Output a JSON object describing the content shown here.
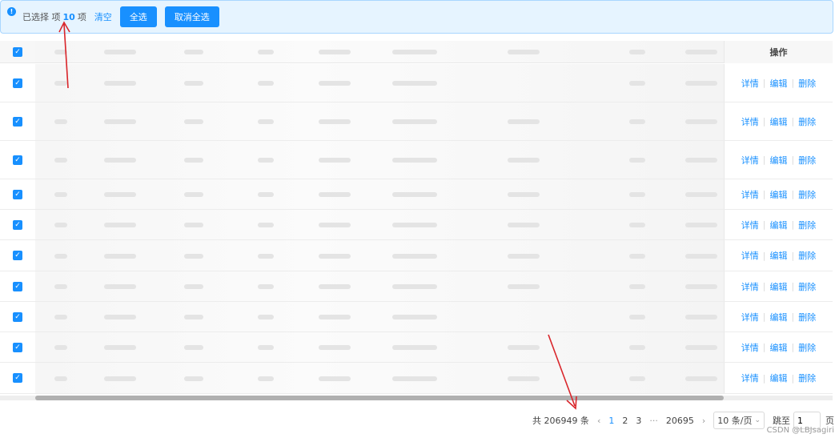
{
  "alert": {
    "prefix": "已选择 项",
    "count": "10",
    "suffix": "项",
    "clear_label": "清空",
    "select_all_label": "全选",
    "deselect_all_label": "取消全选"
  },
  "table": {
    "ops_header": "操作",
    "rows": [
      {
        "detail": "详情",
        "edit": "编辑",
        "delete": "删除"
      },
      {
        "detail": "详情",
        "edit": "编辑",
        "delete": "删除"
      },
      {
        "detail": "详情",
        "edit": "编辑",
        "delete": "删除"
      },
      {
        "detail": "详情",
        "edit": "编辑",
        "delete": "删除"
      },
      {
        "detail": "详情",
        "edit": "编辑",
        "delete": "删除"
      },
      {
        "detail": "详情",
        "edit": "编辑",
        "delete": "删除"
      },
      {
        "detail": "详情",
        "edit": "编辑",
        "delete": "删除"
      },
      {
        "detail": "详情",
        "edit": "编辑",
        "delete": "删除"
      },
      {
        "detail": "详情",
        "edit": "编辑",
        "delete": "删除"
      },
      {
        "detail": "详情",
        "edit": "编辑",
        "delete": "删除"
      }
    ]
  },
  "pagination": {
    "total_label": "共 206949 条",
    "prev": "‹",
    "pages": [
      "1",
      "2",
      "3"
    ],
    "ellipsis": "···",
    "last_page": "20695",
    "next": "›",
    "page_size": "10 条/页",
    "jump_label": "跳至",
    "jump_value": "1",
    "page_unit": "页"
  },
  "watermark": "CSDN @LBJsagiri",
  "colors": {
    "accent": "#1890ff",
    "annotation": "#d9262b"
  },
  "icons": {
    "info": "info-icon",
    "check": "check-icon",
    "dropdown": "chevron-down-icon"
  }
}
